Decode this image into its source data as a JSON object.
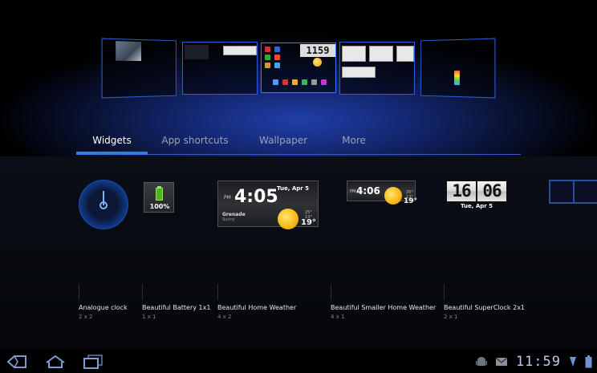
{
  "tabs": [
    {
      "label": "Widgets",
      "active": true
    },
    {
      "label": "App shortcuts",
      "active": false
    },
    {
      "label": "Wallpaper",
      "active": false
    },
    {
      "label": "More",
      "active": false
    }
  ],
  "previews": {
    "clock_text": "1159"
  },
  "widgets": [
    {
      "name": "Analogue clock",
      "size": "2 x 2"
    },
    {
      "name": "Beautiful Battery 1x1",
      "size": "1 x 1",
      "battery_percent": "100%"
    },
    {
      "name": "Beautiful Home Weather",
      "size": "4 x 2",
      "time": "4:05",
      "meridiem": "PM",
      "date": "Tue, Apr 5",
      "city": "Grenade",
      "condition": "Sunny",
      "temp": "19°",
      "hilo": "25° 13°"
    },
    {
      "name": "Beautiful Smaller Home Weather",
      "size": "4 x 1",
      "time": "4:06",
      "meridiem": "PM",
      "temp": "19°",
      "hilo": "25° 13°"
    },
    {
      "name": "Beautiful SuperClock 2x1",
      "size": "2 x 1",
      "hours": "16",
      "minutes": "06",
      "date": "Tue, Apr 5"
    }
  ],
  "status_bar": {
    "clock": "11:59"
  },
  "colors": {
    "accent": "#3a78e8",
    "tab_line": "#3a5bb8",
    "clock": "#b8cdee"
  }
}
